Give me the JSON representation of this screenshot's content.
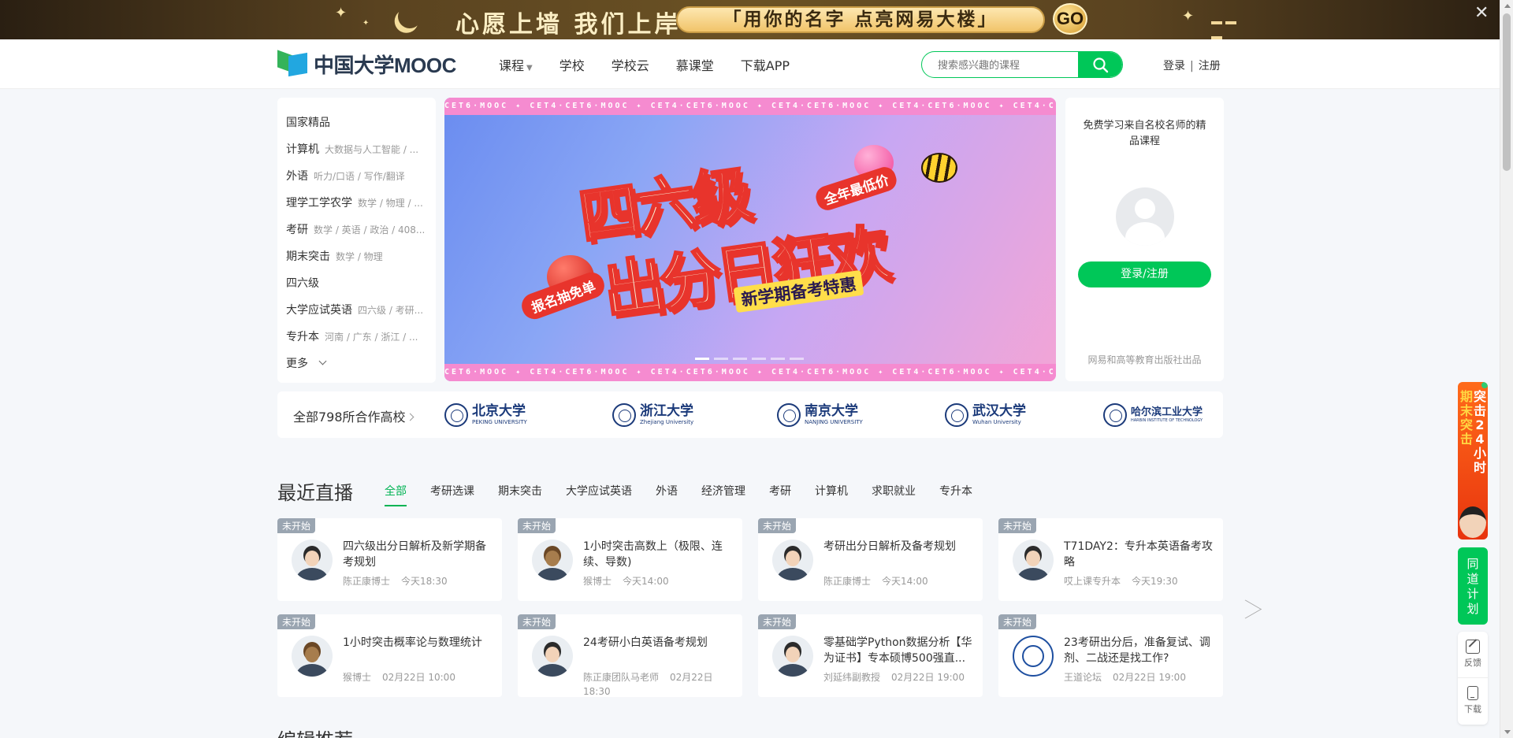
{
  "promo_banner": {
    "slogan": "心愿上墙 我们上岸",
    "pill_text": "「用你的名字 点亮网易大楼」",
    "go_label": "GO",
    "close_glyph": "✕",
    "colors": {
      "bg": "#5a4320",
      "pill": "#f1c46a"
    }
  },
  "header": {
    "logo_text": "中国大学MOOC",
    "nav": [
      "课程",
      "学校",
      "学校云",
      "慕课堂",
      "下载APP"
    ],
    "search_placeholder": "搜索感兴趣的课程",
    "login": "登录",
    "separator": "|",
    "register": "注册",
    "accent": "#00c758"
  },
  "categories": [
    {
      "name": "国家精品",
      "sub": ""
    },
    {
      "name": "计算机",
      "sub": "大数据与人工智能 / ..."
    },
    {
      "name": "外语",
      "sub": "听力/口语 / 写作/翻译"
    },
    {
      "name": "理学工学农学",
      "sub": "数学 / 物理 / ..."
    },
    {
      "name": "考研",
      "sub": "数学 / 英语 / 政治 / 408..."
    },
    {
      "name": "期末突击",
      "sub": "数学 / 物理"
    },
    {
      "name": "四六级",
      "sub": ""
    },
    {
      "name": "大学应试英语",
      "sub": "四六级 / 考研..."
    },
    {
      "name": "专升本",
      "sub": "河南 / 广东 / 浙江 / ..."
    }
  ],
  "categories_more": "更多",
  "carousel": {
    "strip_text": "CET6·MOOC ✦ CET4·CET6·MOOC ✦ CET4·CET6·MOOC ✦ CET4·CET6·MOOC ✦ CET4·CET6·MOOC ✦ CET4·CET6·MOOC ✦ CET4·CET6·MOOC ✦",
    "headline_1": "四六级",
    "headline_2": "出分日狂欢",
    "badge_year": "全年最低价",
    "badge_free": "报名抽免单",
    "badge_new": "新学期备考特惠",
    "slide_count": 6,
    "active_slide": 1
  },
  "login_panel": {
    "title": "免费学习来自名校名师的精品课程",
    "button": "登录/注册",
    "footer": "网易和高等教育出版社出品"
  },
  "partners": {
    "all_label": "全部798所合作高校",
    "schools": [
      {
        "zh": "北京大学",
        "en": "PEKING UNIVERSITY"
      },
      {
        "zh": "浙江大学",
        "en": "Zhejiang University"
      },
      {
        "zh": "南京大学",
        "en": "NANJING UNIVERSITY"
      },
      {
        "zh": "武汉大学",
        "en": "Wuhan University"
      },
      {
        "zh": "哈尔滨工业大学",
        "en": "HARBIN INSTITUTE OF TECHNOLOGY"
      }
    ]
  },
  "live": {
    "title": "最近直播",
    "tabs": [
      "全部",
      "考研选课",
      "期末突击",
      "大学应试英语",
      "外语",
      "经济管理",
      "考研",
      "计算机",
      "求职就业",
      "专升本"
    ],
    "active_tab": 0,
    "cards": [
      {
        "tag": "未开始",
        "title": "四六级出分日解析及新学期备考规划",
        "teacher": "陈正康博士",
        "time": "今天18:30",
        "avatar": "person"
      },
      {
        "tag": "未开始",
        "title": "1小时突击高数上（极限、连续、导数)",
        "teacher": "猴博士",
        "time": "今天14:00",
        "avatar": "monkey"
      },
      {
        "tag": "未开始",
        "title": "考研出分日解析及备考规划",
        "teacher": "陈正康博士",
        "time": "今天14:00",
        "avatar": "person"
      },
      {
        "tag": "未开始",
        "title": "T71DAY2：专升本英语备考攻略",
        "teacher": "哎上课专升本",
        "time": "今天19:30",
        "avatar": "person"
      },
      {
        "tag": "未开始",
        "title": "1小时突击概率论与数理统计",
        "teacher": "猴博士",
        "time": "02月22日 10:00",
        "avatar": "monkey"
      },
      {
        "tag": "未开始",
        "title": "24考研小白英语备考规划",
        "teacher": "陈正康团队马老师",
        "time": "02月22日 18:30",
        "avatar": "person"
      },
      {
        "tag": "未开始",
        "title": "零基础学Python数据分析【华为证书】专本硕博500强直...",
        "teacher": "刘延纬副教授",
        "time": "02月22日 19:00",
        "avatar": "person"
      },
      {
        "tag": "未开始",
        "title": "23考研出分后，准备复试、调剂、二战还是找工作?",
        "teacher": "王道论坛",
        "time": "02月22日 19:00",
        "avatar": "logo"
      }
    ]
  },
  "next_section_title": "编辑推荐",
  "floating": {
    "promo_col1": "期末突击",
    "promo_col2": "突击24小时",
    "promo_col1_full": "期末突击",
    "plan": "同道计划",
    "feedback": "反馈",
    "download": "下载"
  }
}
